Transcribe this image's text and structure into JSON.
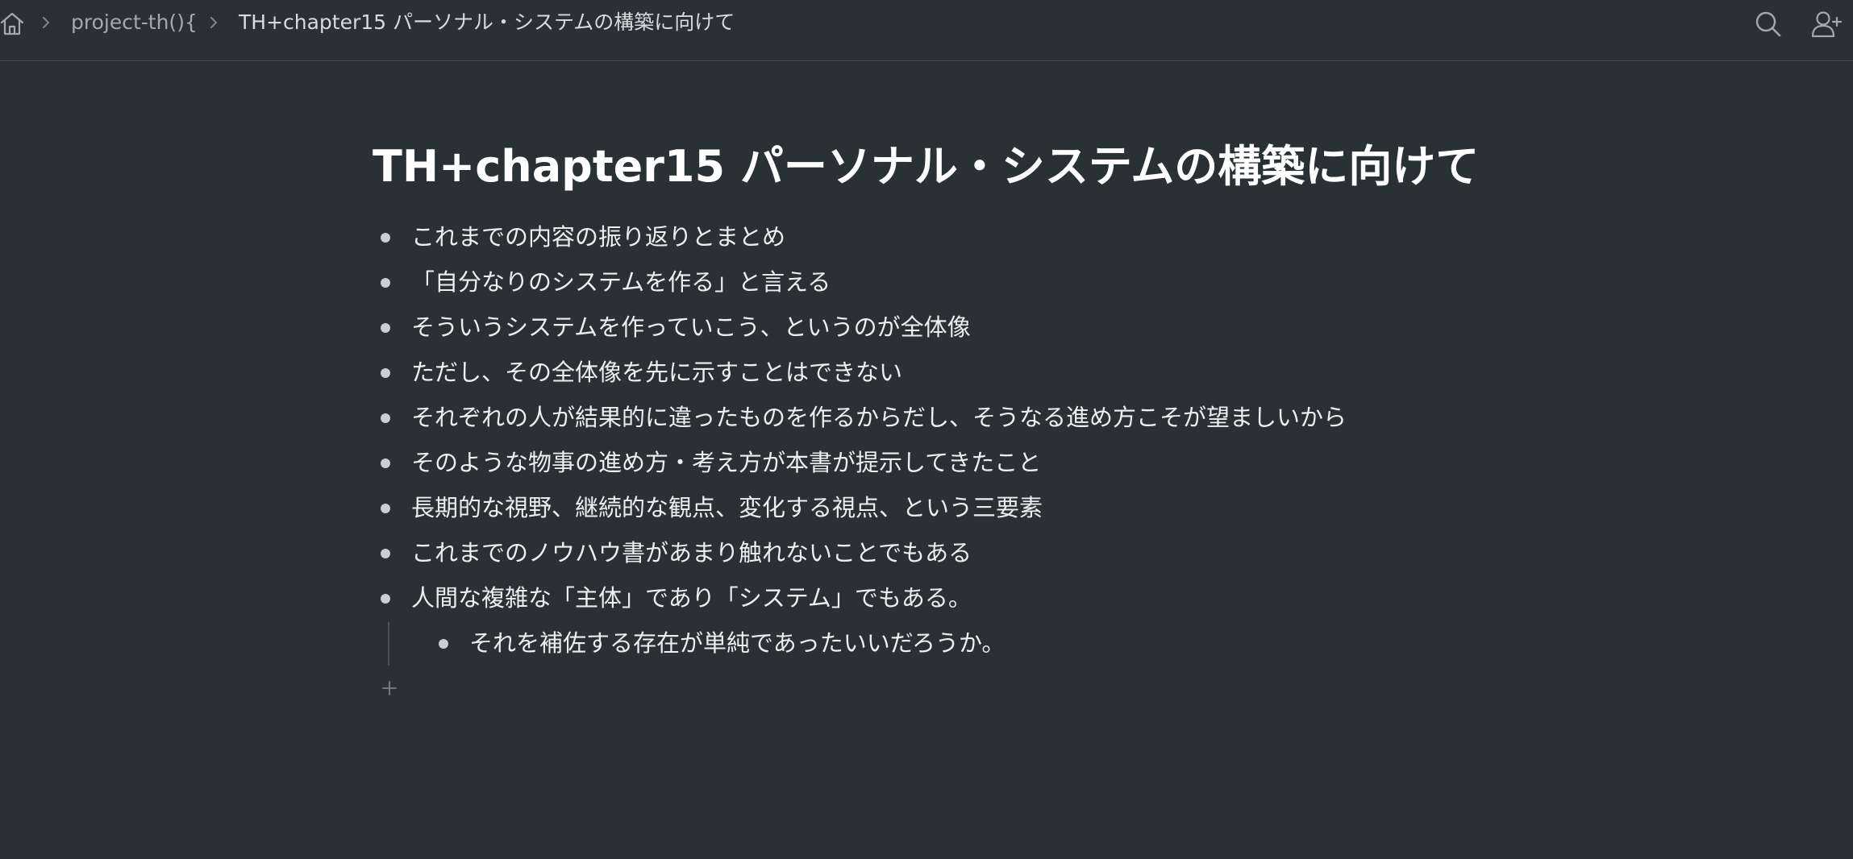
{
  "breadcrumb": {
    "home_icon": "home-icon",
    "separator_icon": "chevron-right-icon",
    "project": "project-th(){",
    "current": "TH+chapter15 パーソナル・システムの構築に向けて"
  },
  "toolbar": {
    "search_icon": "search-icon",
    "add_user_icon": "add-user-icon"
  },
  "page": {
    "title": "TH+chapter15 パーソナル・システムの構築に向けて",
    "bullets": [
      "これまでの内容の振り返りとまとめ",
      "「自分なりのシステムを作る」と言える",
      "そういうシステムを作っていこう、というのが全体像",
      "ただし、その全体像を先に示すことはできない",
      "それぞれの人が結果的に違ったものを作るからだし、そうなる進め方こそが望ましいから",
      "そのような物事の進め方・考え方が本書が提示してきたこと",
      "長期的な視野、継続的な観点、変化する視点、という三要素",
      "これまでのノウハウ書があまり触れないことでもある",
      "人間な複雑な「主体」であり「システム」でもある。"
    ],
    "child_bullet": "それを補佐する存在が単純であったいいだろうか。",
    "add_icon": "plus-icon"
  },
  "colors": {
    "background": "#2a3135",
    "text": "#eceff0",
    "muted": "#a3aaae",
    "bullet": "#c9ced1"
  }
}
